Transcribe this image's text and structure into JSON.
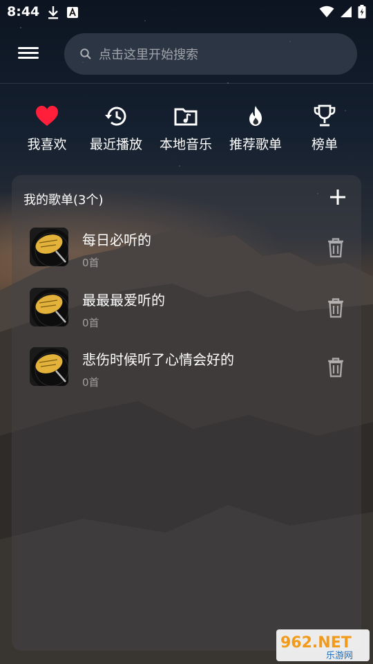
{
  "status_bar": {
    "time": "8:44",
    "left_icons": [
      "download-icon",
      "text-a-icon"
    ],
    "right_icons": [
      "wifi-icon",
      "signal-icon",
      "battery-charging-icon"
    ]
  },
  "header": {
    "menu_icon": "hamburger-menu-icon",
    "search": {
      "placeholder": "点击这里开始搜索",
      "icon": "search-icon"
    }
  },
  "quick_nav": [
    {
      "label": "我喜欢",
      "icon": "heart-icon",
      "icon_color": "#ff1f3a"
    },
    {
      "label": "最近播放",
      "icon": "history-icon",
      "icon_color": "#ffffff"
    },
    {
      "label": "本地音乐",
      "icon": "music-folder-icon",
      "icon_color": "#ffffff"
    },
    {
      "label": "推荐歌单",
      "icon": "flame-icon",
      "icon_color": "#ffffff"
    },
    {
      "label": "榜单",
      "icon": "trophy-icon",
      "icon_color": "#ffffff"
    }
  ],
  "playlists": {
    "title": "我的歌单(3个)",
    "add_icon": "plus-icon",
    "items": [
      {
        "title": "每日必听的",
        "count": "0首",
        "cover_icon": "vinyl-record-icon",
        "delete_icon": "trash-icon"
      },
      {
        "title": "最最最爱听的",
        "count": "0首",
        "cover_icon": "vinyl-record-icon",
        "delete_icon": "trash-icon"
      },
      {
        "title": "悲伤时候听了心情会好的",
        "count": "0首",
        "cover_icon": "vinyl-record-icon",
        "delete_icon": "trash-icon"
      }
    ]
  },
  "watermark": {
    "brand": "962.NET",
    "sub": "乐游网"
  },
  "colors": {
    "accent_heart": "#ff1f3a",
    "text_primary": "#ffffff",
    "text_secondary": "rgba(255,255,255,0.5)"
  }
}
